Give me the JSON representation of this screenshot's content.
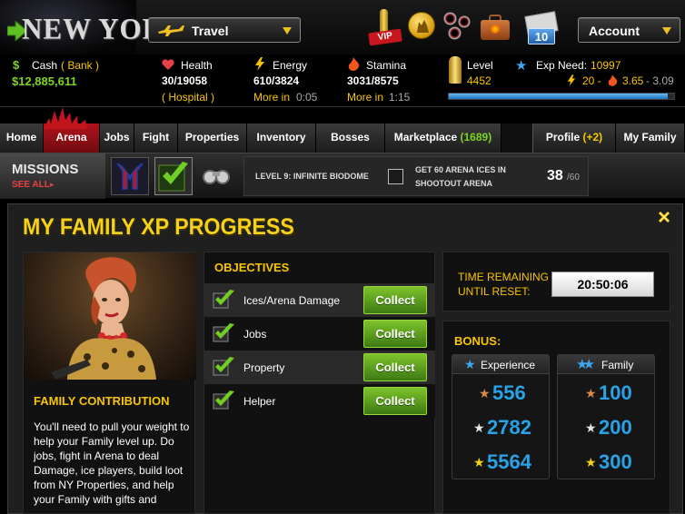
{
  "header": {
    "logo_text": "NEW YORK",
    "travel_label": "Travel",
    "vip_label": "VIP",
    "mail_count": "10",
    "account_label": "Account"
  },
  "stats": {
    "cash_label": "Cash",
    "bank_label": "( Bank )",
    "cash_value": "$12,885,611",
    "health_label": "Health",
    "health_value": "30/19058",
    "hospital_label": "( Hospital )",
    "energy_label": "Energy",
    "energy_value": "610/3824",
    "energy_more_label": "More in",
    "energy_more_time": "0:05",
    "stamina_label": "Stamina",
    "stamina_value": "3031/8575",
    "stamina_more_label": "More in",
    "stamina_more_time": "1:15",
    "level_label": "Level",
    "level_value": "4452",
    "exp_label": "Exp Need:",
    "exp_value": "10997",
    "ratio_energy": "20 -",
    "ratio_stamina": "3.65",
    "ratio_total": "- 3.09",
    "exp_progress": 0.97
  },
  "nav": {
    "items": [
      "Home",
      "Arena",
      "Jobs",
      "Fight",
      "Properties",
      "Inventory",
      "Bosses",
      "Marketplace"
    ],
    "marketplace_count": "(1689)",
    "profile_label": "Profile",
    "profile_count": "(+2)",
    "myfamily_label": "My Family"
  },
  "missions": {
    "title": "MISSIONS",
    "see_all": "SEE ALL",
    "level_text": "LEVEL 9: INFINITE BIODOME",
    "task_text_1": "GET 60 ARENA ICES IN",
    "task_text_2": "SHOOTOUT ARENA",
    "progress_current": "38",
    "progress_total": "/60"
  },
  "panel": {
    "title": "MY FAMILY XP PROGRESS",
    "contribution_title": "FAMILY CONTRIBUTION",
    "contribution_text": "You'll need to pull your weight to help your Family level up. Do jobs, fight in Arena to deal Damage, ice players, build loot from NY Properties, and help your Family with gifts and",
    "objectives_title": "OBJECTIVES",
    "objectives": [
      {
        "label": "Ices/Arena Damage",
        "button": "Collect"
      },
      {
        "label": "Jobs",
        "button": "Collect"
      },
      {
        "label": "Property",
        "button": "Collect"
      },
      {
        "label": "Helper",
        "button": "Collect"
      }
    ],
    "time_label_1": "TIME REMAINING",
    "time_label_2": "UNTIL RESET:",
    "time_value": "20:50:06",
    "bonus_title": "BONUS:",
    "experience_label": "Experience",
    "family_label": "Family",
    "experience_values": [
      "556",
      "2782",
      "5564"
    ],
    "family_values": [
      "100",
      "200",
      "300"
    ]
  },
  "colors": {
    "gold": "#f7c600",
    "accent_red": "#b3121b",
    "collect_green": "#5ea11f",
    "bonus_blue": "#29a3e8"
  }
}
